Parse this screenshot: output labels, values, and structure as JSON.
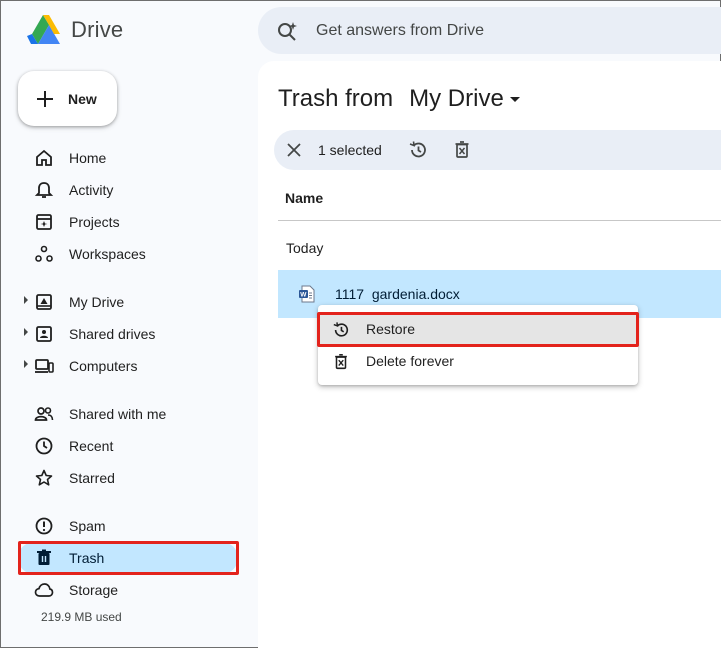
{
  "app": {
    "name": "Drive"
  },
  "search": {
    "placeholder": "Get answers from Drive"
  },
  "new_button": {
    "label": "New"
  },
  "sidebar": {
    "items": [
      {
        "label": "Home"
      },
      {
        "label": "Activity"
      },
      {
        "label": "Projects"
      },
      {
        "label": "Workspaces"
      },
      {
        "label": "My Drive"
      },
      {
        "label": "Shared drives"
      },
      {
        "label": "Computers"
      },
      {
        "label": "Shared with me"
      },
      {
        "label": "Recent"
      },
      {
        "label": "Starred"
      },
      {
        "label": "Spam"
      },
      {
        "label": "Trash"
      },
      {
        "label": "Storage"
      }
    ],
    "active": "Trash",
    "storage_used": "219.9 MB used"
  },
  "main": {
    "title_prefix": "Trash from",
    "title_location": "My Drive",
    "selection": {
      "count_label": "1 selected"
    },
    "columns": {
      "name": "Name"
    },
    "groups": [
      {
        "label": "Today",
        "files": [
          {
            "name_prefix": "1117",
            "name_rest": "gardenia.docx",
            "type": "word-doc",
            "selected": true
          }
        ]
      }
    ]
  },
  "context_menu": {
    "items": [
      {
        "label": "Restore",
        "icon": "restore-icon"
      },
      {
        "label": "Delete forever",
        "icon": "delete-forever-icon"
      }
    ]
  },
  "colors": {
    "accent": "#0b57d0",
    "selected_bg": "#c2e7ff",
    "highlight_box": "#e3231c"
  }
}
